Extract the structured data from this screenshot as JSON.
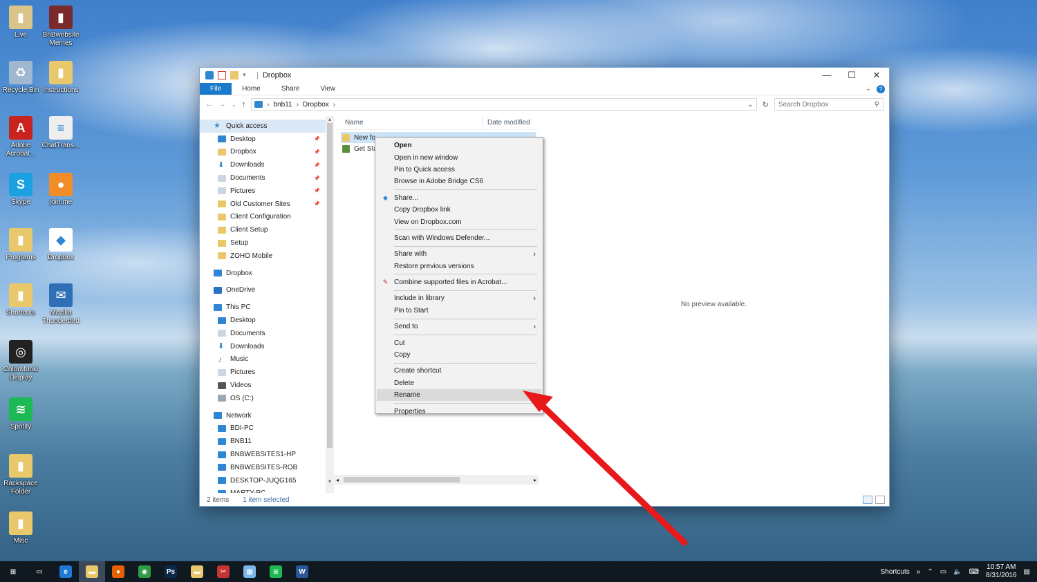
{
  "desktop": {
    "icons": [
      {
        "label": "Live",
        "color": "#d9c58a",
        "glyph": "▮"
      },
      {
        "label": "BnBwebsite Memes",
        "color": "#7a2a2a",
        "glyph": "▮"
      },
      {
        "label": "Recycle Bin",
        "color": "#9fb8cf",
        "glyph": "♻"
      },
      {
        "label": "Instructions",
        "color": "#e8c86a",
        "glyph": "▮"
      },
      {
        "label": "Adobe Acrobat...",
        "color": "#c8231f",
        "glyph": "A"
      },
      {
        "label": "ChatTrans...",
        "color": "#eeeeee",
        "glyph": "≡"
      },
      {
        "label": "Skype",
        "color": "#1ba1e2",
        "glyph": "S"
      },
      {
        "label": "join.me",
        "color": "#f28c28",
        "glyph": "●"
      },
      {
        "label": "Programs",
        "color": "#e8c86a",
        "glyph": "▮"
      },
      {
        "label": "Dropbox",
        "color": "#ffffff",
        "glyph": "◆"
      },
      {
        "label": "Shortcuts",
        "color": "#e8c86a",
        "glyph": "▮"
      },
      {
        "label": "Mozilla Thunderbird",
        "color": "#2f6fb5",
        "glyph": "✉"
      },
      {
        "label": "ColorMunki Display",
        "color": "#222222",
        "glyph": "◎"
      },
      {
        "label": "Spotify",
        "color": "#1db954",
        "glyph": "≋"
      },
      {
        "label": "Rackspace Folder",
        "color": "#e8c86a",
        "glyph": "▮"
      },
      {
        "label": "Misc",
        "color": "#e8c86a",
        "glyph": "▮"
      }
    ]
  },
  "window": {
    "title": "Dropbox",
    "tabs": {
      "file": "File",
      "home": "Home",
      "share": "Share",
      "view": "View"
    },
    "breadcrumb": [
      "bnb11",
      "Dropbox"
    ],
    "search_placeholder": "Search Dropbox",
    "nav": [
      {
        "label": "Quick access",
        "icon": "star",
        "color": "#3b8fd8",
        "level": 0,
        "selected": true
      },
      {
        "label": "Desktop",
        "icon": "desktop",
        "color": "#2f86d2",
        "level": 1,
        "pinned": true
      },
      {
        "label": "Dropbox",
        "icon": "folder",
        "color": "#e8c86a",
        "level": 1,
        "pinned": true
      },
      {
        "label": "Downloads",
        "icon": "download",
        "color": "#2f86d2",
        "level": 1,
        "pinned": true
      },
      {
        "label": "Documents",
        "icon": "document",
        "color": "#c9d6e3",
        "level": 1,
        "pinned": true
      },
      {
        "label": "Pictures",
        "icon": "pictures",
        "color": "#c9d6e3",
        "level": 1,
        "pinned": true
      },
      {
        "label": "Old Customer Sites",
        "icon": "folder",
        "color": "#e8c86a",
        "level": 1,
        "pinned": true
      },
      {
        "label": "Client Configuration",
        "icon": "folder",
        "color": "#e8c86a",
        "level": 1
      },
      {
        "label": "Client Setup",
        "icon": "folder",
        "color": "#e8c86a",
        "level": 1
      },
      {
        "label": "Setup",
        "icon": "folder",
        "color": "#e8c86a",
        "level": 1
      },
      {
        "label": "ZOHO Mobile",
        "icon": "folder",
        "color": "#e8c86a",
        "level": 1
      },
      {
        "gap": true
      },
      {
        "label": "Dropbox",
        "icon": "dropbox",
        "color": "#2f86d2",
        "level": 0
      },
      {
        "gap": true
      },
      {
        "label": "OneDrive",
        "icon": "cloud",
        "color": "#2a72c4",
        "level": 0
      },
      {
        "gap": true
      },
      {
        "label": "This PC",
        "icon": "pc",
        "color": "#2f86d2",
        "level": 0
      },
      {
        "label": "Desktop",
        "icon": "desktop",
        "color": "#2f86d2",
        "level": 1
      },
      {
        "label": "Documents",
        "icon": "document",
        "color": "#c9d6e3",
        "level": 1
      },
      {
        "label": "Downloads",
        "icon": "download",
        "color": "#2f86d2",
        "level": 1
      },
      {
        "label": "Music",
        "icon": "music",
        "color": "#2f86d2",
        "level": 1
      },
      {
        "label": "Pictures",
        "icon": "pictures",
        "color": "#c9d6e3",
        "level": 1
      },
      {
        "label": "Videos",
        "icon": "videos",
        "color": "#555555",
        "level": 1
      },
      {
        "label": "OS (C:)",
        "icon": "drive",
        "color": "#9aa9b8",
        "level": 1
      },
      {
        "gap": true
      },
      {
        "label": "Network",
        "icon": "network",
        "color": "#2f86d2",
        "level": 0
      },
      {
        "label": "BDI-PC",
        "icon": "computer",
        "color": "#2f86d2",
        "level": 1
      },
      {
        "label": "BNB11",
        "icon": "computer",
        "color": "#2f86d2",
        "level": 1
      },
      {
        "label": "BNBWEBSITES1-HP",
        "icon": "computer",
        "color": "#2f86d2",
        "level": 1
      },
      {
        "label": "BNBWEBSITES-ROB",
        "icon": "computer",
        "color": "#2f86d2",
        "level": 1
      },
      {
        "label": "DESKTOP-JUQG165",
        "icon": "computer",
        "color": "#2f86d2",
        "level": 1
      },
      {
        "label": "MARTY-PC",
        "icon": "computer",
        "color": "#2f86d2",
        "level": 1
      }
    ],
    "columns": {
      "name": "Name",
      "date_modified": "Date modified"
    },
    "files": [
      {
        "name": "New fo",
        "icon": "folder",
        "color": "#e8c86a",
        "selected": true
      },
      {
        "name": "Get Sta",
        "icon": "pdf",
        "color": "#5a8f3a",
        "selected": false
      }
    ],
    "preview_text": "No preview available.",
    "status": {
      "items": "2 items",
      "selected": "1 item selected"
    }
  },
  "context_menu": {
    "groups": [
      [
        {
          "label": "Open",
          "bold": true
        },
        {
          "label": "Open in new window"
        },
        {
          "label": "Pin to Quick access"
        },
        {
          "label": "Browse in Adobe Bridge CS6"
        }
      ],
      [
        {
          "label": "Share...",
          "icon": "dropbox-icon"
        },
        {
          "label": "Copy Dropbox link"
        },
        {
          "label": "View on Dropbox.com"
        }
      ],
      [
        {
          "label": "Scan with Windows Defender..."
        }
      ],
      [
        {
          "label": "Share with",
          "submenu": true
        },
        {
          "label": "Restore previous versions"
        }
      ],
      [
        {
          "label": "Combine supported files in Acrobat...",
          "icon": "acrobat-icon"
        }
      ],
      [
        {
          "label": "Include in library",
          "submenu": true
        },
        {
          "label": "Pin to Start"
        }
      ],
      [
        {
          "label": "Send to",
          "submenu": true
        }
      ],
      [
        {
          "label": "Cut"
        },
        {
          "label": "Copy"
        }
      ],
      [
        {
          "label": "Create shortcut"
        },
        {
          "label": "Delete"
        },
        {
          "label": "Rename",
          "highlighted": true
        }
      ],
      [
        {
          "label": "Properties"
        }
      ]
    ]
  },
  "annotation": {
    "arrow_color": "#e8191b"
  },
  "taskbar": {
    "apps": [
      {
        "name": "start-button",
        "glyph": "⊞",
        "color": "#101820"
      },
      {
        "name": "task-view-button",
        "glyph": "▭",
        "color": "#101820"
      },
      {
        "name": "edge-icon",
        "glyph": "e",
        "color": "#1e78d6"
      },
      {
        "name": "file-explorer-icon",
        "glyph": "▬",
        "color": "#e8c86a",
        "active": true
      },
      {
        "name": "firefox-icon",
        "glyph": "●",
        "color": "#e66000"
      },
      {
        "name": "chrome-icon",
        "glyph": "◉",
        "color": "#2e9b45"
      },
      {
        "name": "photoshop-icon",
        "glyph": "Ps",
        "color": "#0b2a4a"
      },
      {
        "name": "folder-icon",
        "glyph": "▬",
        "color": "#e8c86a"
      },
      {
        "name": "snipping-icon",
        "glyph": "✂",
        "color": "#c53434"
      },
      {
        "name": "notepad-icon",
        "glyph": "▦",
        "color": "#7bb7e8"
      },
      {
        "name": "spotify-icon",
        "glyph": "≋",
        "color": "#1db954"
      },
      {
        "name": "word-icon",
        "glyph": "W",
        "color": "#2b579a"
      }
    ],
    "shortcuts_label": "Shortcuts",
    "time": "10:57 AM",
    "date": "8/31/2016"
  }
}
